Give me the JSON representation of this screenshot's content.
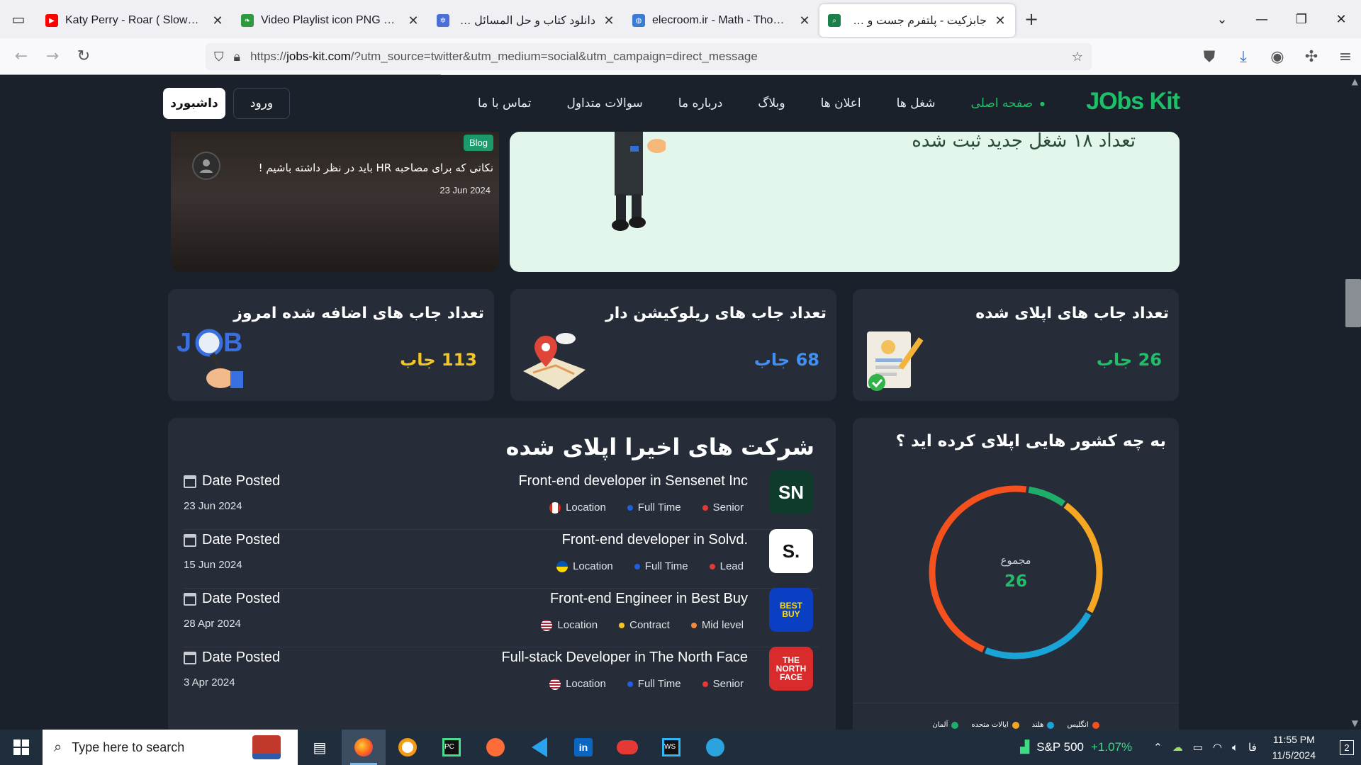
{
  "browser": {
    "tabs": [
      {
        "title": "Katy Perry - Roar ( Slowed + Re",
        "favicon": "youtube-icon",
        "rtl": false
      },
      {
        "title": "Video Playlist icon PNG and SV",
        "favicon": "leaf-icon",
        "rtl": false
      },
      {
        "title": "دانلود کتاب و حل المسائل ریاض",
        "favicon": "gear-icon",
        "rtl": true
      },
      {
        "title": "elecroom.ir - Math - Thomas - I",
        "favicon": "globe-icon",
        "rtl": false
      },
      {
        "title": "جابزکیت - پلتفرم جست و جوی فر",
        "favicon": "search-icon",
        "rtl": true,
        "active": true
      }
    ],
    "url_prefix": "https://",
    "url_host": "jobs-kit.com",
    "url_rest": "/?utm_source=twitter&utm_medium=social&utm_campaign=direct_message"
  },
  "site": {
    "logo": "JObs Kit",
    "menu": [
      "صفحه اصلی",
      "شغل ها",
      "اعلان ها",
      "وبلاگ",
      "درباره ما",
      "سوالات متداول",
      "تماس با ما"
    ],
    "login_label": "ورود",
    "dashboard_label": "داشبورد",
    "hero_heading": "تعداد ۱۸ شغل جدید ثبت شده"
  },
  "blog": {
    "badge": "Blog",
    "title": "نکاتی که برای مصاحبه HR باید در نظر داشته باشیم !",
    "date": "23 Jun 2024"
  },
  "stats": [
    {
      "title": "تعداد جاب های اپلای شده",
      "value": "26 جاب",
      "color": "#1fbf6a"
    },
    {
      "title": "تعداد جاب های ریلوکیشن دار",
      "value": "68 جاب",
      "color": "#3f8ff5"
    },
    {
      "title": "تعداد جاب های اضافه شده امروز",
      "value": "113 جاب",
      "color": "#f3c623"
    }
  ],
  "companies": {
    "title": "شرکت های اخیرا اپلای شده",
    "date_label": "Date Posted",
    "location_label": "Location",
    "jobs": [
      {
        "title": "Front-end developer in Sensenet Inc",
        "date": "23 Jun 2024",
        "type": "Full Time",
        "level": "Senior",
        "logo_text": "SN",
        "logo_bg": "#0f3b2c",
        "flag": "canada",
        "type_color": "#1f5fe0",
        "level_color": "#e53935"
      },
      {
        "title": "Front-end developer in Solvd.",
        "date": "15 Jun 2024",
        "type": "Full Time",
        "level": "Lead",
        "logo_text": "S.",
        "logo_bg": "#ffffff",
        "flag": "ukraine",
        "type_color": "#1f5fe0",
        "level_color": "#e53935"
      },
      {
        "title": "Front-end Engineer in Best Buy",
        "date": "28 Apr 2024",
        "type": "Contract",
        "level": "Mid level",
        "logo_text": "BEST BUY",
        "logo_bg": "#0a3fc4",
        "flag": "usa",
        "type_color": "#f3c623",
        "level_color": "#f08a3c"
      },
      {
        "title": "Full-stack Developer in The North Face",
        "date": "3 Apr 2024",
        "type": "Full Time",
        "level": "Senior",
        "logo_text": "THE NORTH FACE",
        "logo_bg": "#d92b2b",
        "flag": "usa",
        "type_color": "#1f5fe0",
        "level_color": "#e53935"
      }
    ]
  },
  "countries": {
    "title": "به چه کشور هایی اپلای کرده اید ؟",
    "total_label": "مجموع",
    "total": "26",
    "segments": [
      {
        "name": "انگلیس",
        "value": 12,
        "color": "#f4511e"
      },
      {
        "name": "هلند",
        "value": 6,
        "color": "#1aa3d6"
      },
      {
        "name": "ایالات متحده",
        "value": 6,
        "color": "#f5a623"
      },
      {
        "name": "آلمان",
        "value": 2,
        "color": "#1fae6a"
      }
    ]
  },
  "taskbar": {
    "search_placeholder": "Type here to search",
    "stock_name": "S&P 500",
    "stock_change": "+1.07%",
    "lang": "فا",
    "time": "11:55 PM",
    "date": "11/5/2024",
    "notif_count": "2"
  }
}
